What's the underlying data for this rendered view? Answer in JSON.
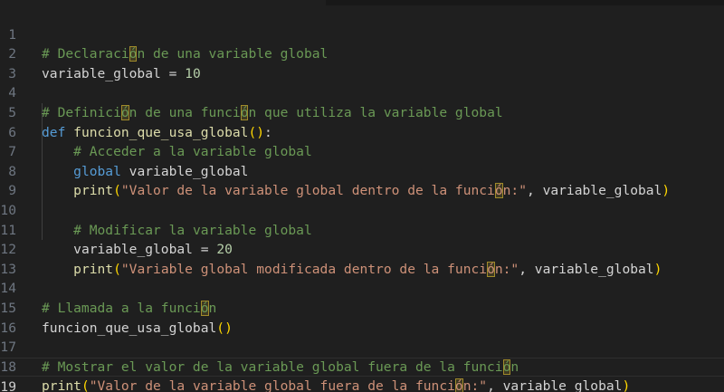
{
  "editor": {
    "line_numbers": [
      "1",
      "2",
      "3",
      "4",
      "5",
      "6",
      "7",
      "8",
      "9",
      "10",
      "11",
      "12",
      "13",
      "14",
      "15",
      "16",
      "17",
      "18",
      "19"
    ],
    "active_line": "19",
    "lines": {
      "l1": {
        "pre": "# Declaraci",
        "hl": "ó",
        "post": "n de una variable global"
      },
      "l2": {
        "name": "variable_global",
        "eq": " = ",
        "num": "10"
      },
      "l4": {
        "a": "# Definici",
        "hl1": "ó",
        "b": "n de una funci",
        "hl2": "ó",
        "c": "n que utiliza la variable global"
      },
      "l5": {
        "kw": "def",
        "fn": "funcion_que_usa_global",
        "paren_open": "()",
        "colon": ":"
      },
      "l6": {
        "text": "# Acceder a la variable global"
      },
      "l7": {
        "kw": "global",
        "name": "variable_global"
      },
      "l8": {
        "fn": "print",
        "open": "(",
        "s1": "\"Valor de la variable global dentro de la funci",
        "hl": "ó",
        "s2": "n:\"",
        "comma": ", ",
        "name": "variable_global",
        "close": ")"
      },
      "l10": {
        "text": "# Modificar la variable global"
      },
      "l11": {
        "name": "variable_global",
        "eq": " = ",
        "num": "20"
      },
      "l12": {
        "fn": "print",
        "open": "(",
        "s1": "\"Variable global modificada dentro de la funci",
        "hl": "ó",
        "s2": "n:\"",
        "comma": ", ",
        "name": "variable_global",
        "close": ")"
      },
      "l14": {
        "pre": "# Llamada a la funci",
        "hl": "ó",
        "post": "n"
      },
      "l15": {
        "fn": "funcion_que_usa_global",
        "parens": "()"
      },
      "l17": {
        "pre": "# Mostrar el valor de la variable global fuera de la funci",
        "hl": "ó",
        "post": "n"
      },
      "l18": {
        "fn": "print",
        "open": "(",
        "s1": "\"Valor de la variable global fuera de la funci",
        "hl": "ó",
        "s2": "n:\"",
        "comma": ", ",
        "name": "variable_global",
        "close": ")"
      }
    },
    "colors": {
      "background": "#1f1f1f",
      "comment": "#6a9955",
      "keyword": "#569cd6",
      "function": "#dcdcaa",
      "variable": "#9cdcfe",
      "number": "#b5cea8",
      "string": "#ce9178",
      "bracket": "#ffd700",
      "unicode_highlight": "#a08a2a"
    }
  }
}
